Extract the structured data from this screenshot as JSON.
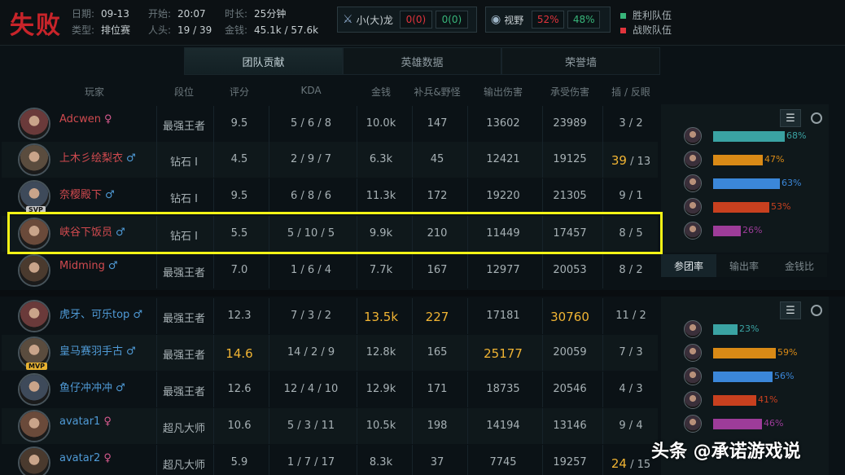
{
  "header": {
    "result": "失败",
    "date_label": "日期:",
    "date": "09-13",
    "start_label": "开始:",
    "start": "20:07",
    "duration_label": "时长:",
    "duration": "25分钟",
    "type_label": "类型:",
    "type": "排位赛",
    "kills_label": "人头:",
    "kills": "19 / 39",
    "gold_label": "金钱:",
    "gold": "45.1k / 57.6k",
    "dragon_label": "小(大)龙",
    "dragon_a": "0(0)",
    "dragon_b": "0(0)",
    "vision_label": "视野",
    "vision_a": "52%",
    "vision_b": "48%",
    "legend_win": "胜利队伍",
    "legend_lose": "战败队伍"
  },
  "tabs": [
    "团队贡献",
    "英雄数据",
    "荣誉墙"
  ],
  "columns": [
    "玩家",
    "段位",
    "评分",
    "KDA",
    "金钱",
    "补兵&野怪",
    "输出伤害",
    "承受伤害",
    "插 / 反眼"
  ],
  "team1": [
    {
      "name": "Adcwen",
      "gender": "♀",
      "rank": "最强王者",
      "score": "9.5",
      "kda": "5 / 6 / 8",
      "gold": "10.0k",
      "cs": "147",
      "dmg": "13602",
      "taken": "23989",
      "wards_a": "3",
      "wards_b": " / 2"
    },
    {
      "name": "上木彡绘梨衣",
      "gender": "♂",
      "rank": "钻石 I",
      "score": "4.5",
      "kda": "2 / 9 / 7",
      "gold": "6.3k",
      "cs": "45",
      "dmg": "12421",
      "taken": "19125",
      "wards_a": "39",
      "wards_b": " / 13"
    },
    {
      "name": "奈樱殿下",
      "gender": "♂",
      "rank": "钻石 I",
      "score": "9.5",
      "kda": "6 / 8 / 6",
      "gold": "11.3k",
      "cs": "172",
      "dmg": "19220",
      "taken": "21305",
      "wards_a": "9",
      "wards_b": " / 1",
      "badge": "SVP"
    },
    {
      "name": "峡谷下饭员",
      "gender": "♂",
      "rank": "钻石 I",
      "score": "5.5",
      "kda": "5 / 10 / 5",
      "gold": "9.9k",
      "cs": "210",
      "dmg": "11449",
      "taken": "17457",
      "wards_a": "8",
      "wards_b": " / 5"
    },
    {
      "name": "Midming",
      "gender": "♂",
      "rank": "最强王者",
      "score": "7.0",
      "kda": "1 / 6 / 4",
      "gold": "7.7k",
      "cs": "167",
      "dmg": "12977",
      "taken": "20053",
      "wards_a": "8",
      "wards_b": " / 2"
    }
  ],
  "team2": [
    {
      "name": "虎牙、可乐top",
      "gender": "♂",
      "rank": "最强王者",
      "score": "12.3",
      "kda": "7 / 3 / 2",
      "gold": "13.5k",
      "cs": "227",
      "dmg": "17181",
      "taken": "30760",
      "wards_a": "11",
      "wards_b": " / 2"
    },
    {
      "name": "皇马赛羽手古",
      "gender": "♂",
      "rank": "最强王者",
      "score": "14.6",
      "kda": "14 / 2 / 9",
      "gold": "12.8k",
      "cs": "165",
      "dmg": "25177",
      "taken": "20059",
      "wards_a": "7",
      "wards_b": " / 3",
      "badge": "MVP"
    },
    {
      "name": "鱼仔冲冲冲",
      "gender": "♂",
      "rank": "最强王者",
      "score": "12.6",
      "kda": "12 / 4 / 10",
      "gold": "12.9k",
      "cs": "171",
      "dmg": "18735",
      "taken": "20546",
      "wards_a": "4",
      "wards_b": " / 3"
    },
    {
      "name": "avatar1",
      "gender": "♀",
      "rank": "超凡大师",
      "score": "10.6",
      "kda": "5 / 3 / 11",
      "gold": "10.5k",
      "cs": "198",
      "dmg": "14194",
      "taken": "13146",
      "wards_a": "9",
      "wards_b": " / 4"
    },
    {
      "name": "avatar2",
      "gender": "♀",
      "rank": "超凡大师",
      "score": "5.9",
      "kda": "1 / 7 / 17",
      "gold": "8.3k",
      "cs": "37",
      "dmg": "7745",
      "taken": "19257",
      "wards_a": "24",
      "wards_b": " / 15"
    }
  ],
  "panel1": [
    {
      "pct": "68%",
      "value": 0.68,
      "color": "#3aa3a3"
    },
    {
      "pct": "47%",
      "value": 0.47,
      "color": "#d98a16"
    },
    {
      "pct": "63%",
      "value": 0.63,
      "color": "#3b87d9"
    },
    {
      "pct": "53%",
      "value": 0.53,
      "color": "#c8401f"
    },
    {
      "pct": "26%",
      "value": 0.26,
      "color": "#9d3c99"
    }
  ],
  "panel2": [
    {
      "pct": "23%",
      "value": 0.23,
      "color": "#3aa3a3"
    },
    {
      "pct": "59%",
      "value": 0.59,
      "color": "#d98a16"
    },
    {
      "pct": "56%",
      "value": 0.56,
      "color": "#3b87d9"
    },
    {
      "pct": "41%",
      "value": 0.41,
      "color": "#c8401f"
    },
    {
      "pct": "46%",
      "value": 0.46,
      "color": "#9d3c99"
    }
  ],
  "panel_tabs": [
    "参团率",
    "输出率",
    "金钱比"
  ],
  "watermark": "头条 @承诺游戏说"
}
